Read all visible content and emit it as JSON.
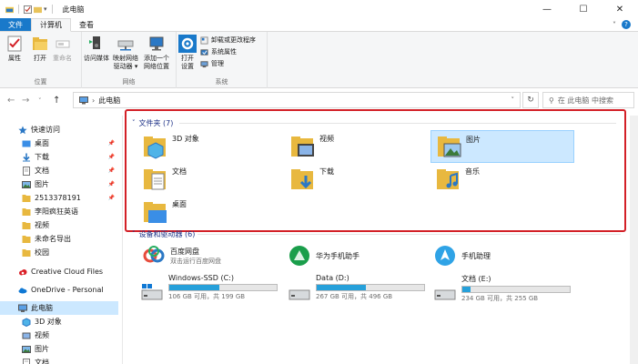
{
  "window": {
    "title": "此电脑",
    "minimize": "—",
    "maximize": "☐",
    "close": "✕"
  },
  "tabs": [
    {
      "label": "文件"
    },
    {
      "label": "计算机"
    },
    {
      "label": "查看"
    }
  ],
  "ribbon": {
    "location": {
      "label": "位置",
      "properties": "属性",
      "open": "打开",
      "rename": "重命名"
    },
    "network": {
      "label": "网络",
      "access_media": [
        "访问媒体",
        ""
      ],
      "map_drive": [
        "映射网络",
        "驱动器 ▾"
      ],
      "add_location": [
        "添加一个",
        "网络位置"
      ]
    },
    "system": {
      "label": "系统",
      "open_settings": [
        "打开",
        "设置"
      ],
      "uninstall": "卸载或更改程序",
      "sys_props": "系统属性",
      "manage": "管理"
    }
  },
  "address": {
    "path": "此电脑",
    "search_placeholder": "在 此电脑 中搜索"
  },
  "nav": {
    "items": [
      {
        "label": "快速访问"
      },
      {
        "label": "桌面"
      },
      {
        "label": "下载"
      },
      {
        "label": "文档"
      },
      {
        "label": "图片"
      },
      {
        "label": "2513378191"
      },
      {
        "label": "李阳疯狂英语"
      },
      {
        "label": "视频"
      },
      {
        "label": "未命名导出"
      },
      {
        "label": "校园"
      },
      {
        "label": "Creative Cloud Files"
      },
      {
        "label": "OneDrive - Personal"
      },
      {
        "label": "此电脑"
      },
      {
        "label": "3D 对象"
      },
      {
        "label": "视频"
      },
      {
        "label": "图片"
      },
      {
        "label": "文档"
      }
    ]
  },
  "folders": {
    "header": "文件夹 (7)",
    "items": [
      {
        "label": "3D 对象"
      },
      {
        "label": "视频"
      },
      {
        "label": "图片"
      },
      {
        "label": "文档"
      },
      {
        "label": "下载"
      },
      {
        "label": "音乐"
      },
      {
        "label": "桌面"
      }
    ]
  },
  "devices": {
    "header": "设备和驱动器 (6)",
    "apps": [
      {
        "name": "百度网盘",
        "sub": "双击运行百度网盘"
      },
      {
        "name": "华为手机助手",
        "sub": ""
      },
      {
        "name": "手机助理",
        "sub": ""
      }
    ],
    "drives": [
      {
        "name": "Windows-SSD (C:)",
        "free": "106 GB 可用，共 199 GB",
        "used_fraction": 0.47
      },
      {
        "name": "Data (D:)",
        "free": "267 GB 可用，共 496 GB",
        "used_fraction": 0.46
      },
      {
        "name": "文档 (E:)",
        "free": "234 GB 可用，共 255 GB",
        "used_fraction": 0.08
      }
    ]
  },
  "colors": {
    "accent": "#1979ca",
    "highlight_box": "#d32027",
    "selection": "#cce8ff",
    "drive_fill": "#26a0da"
  }
}
